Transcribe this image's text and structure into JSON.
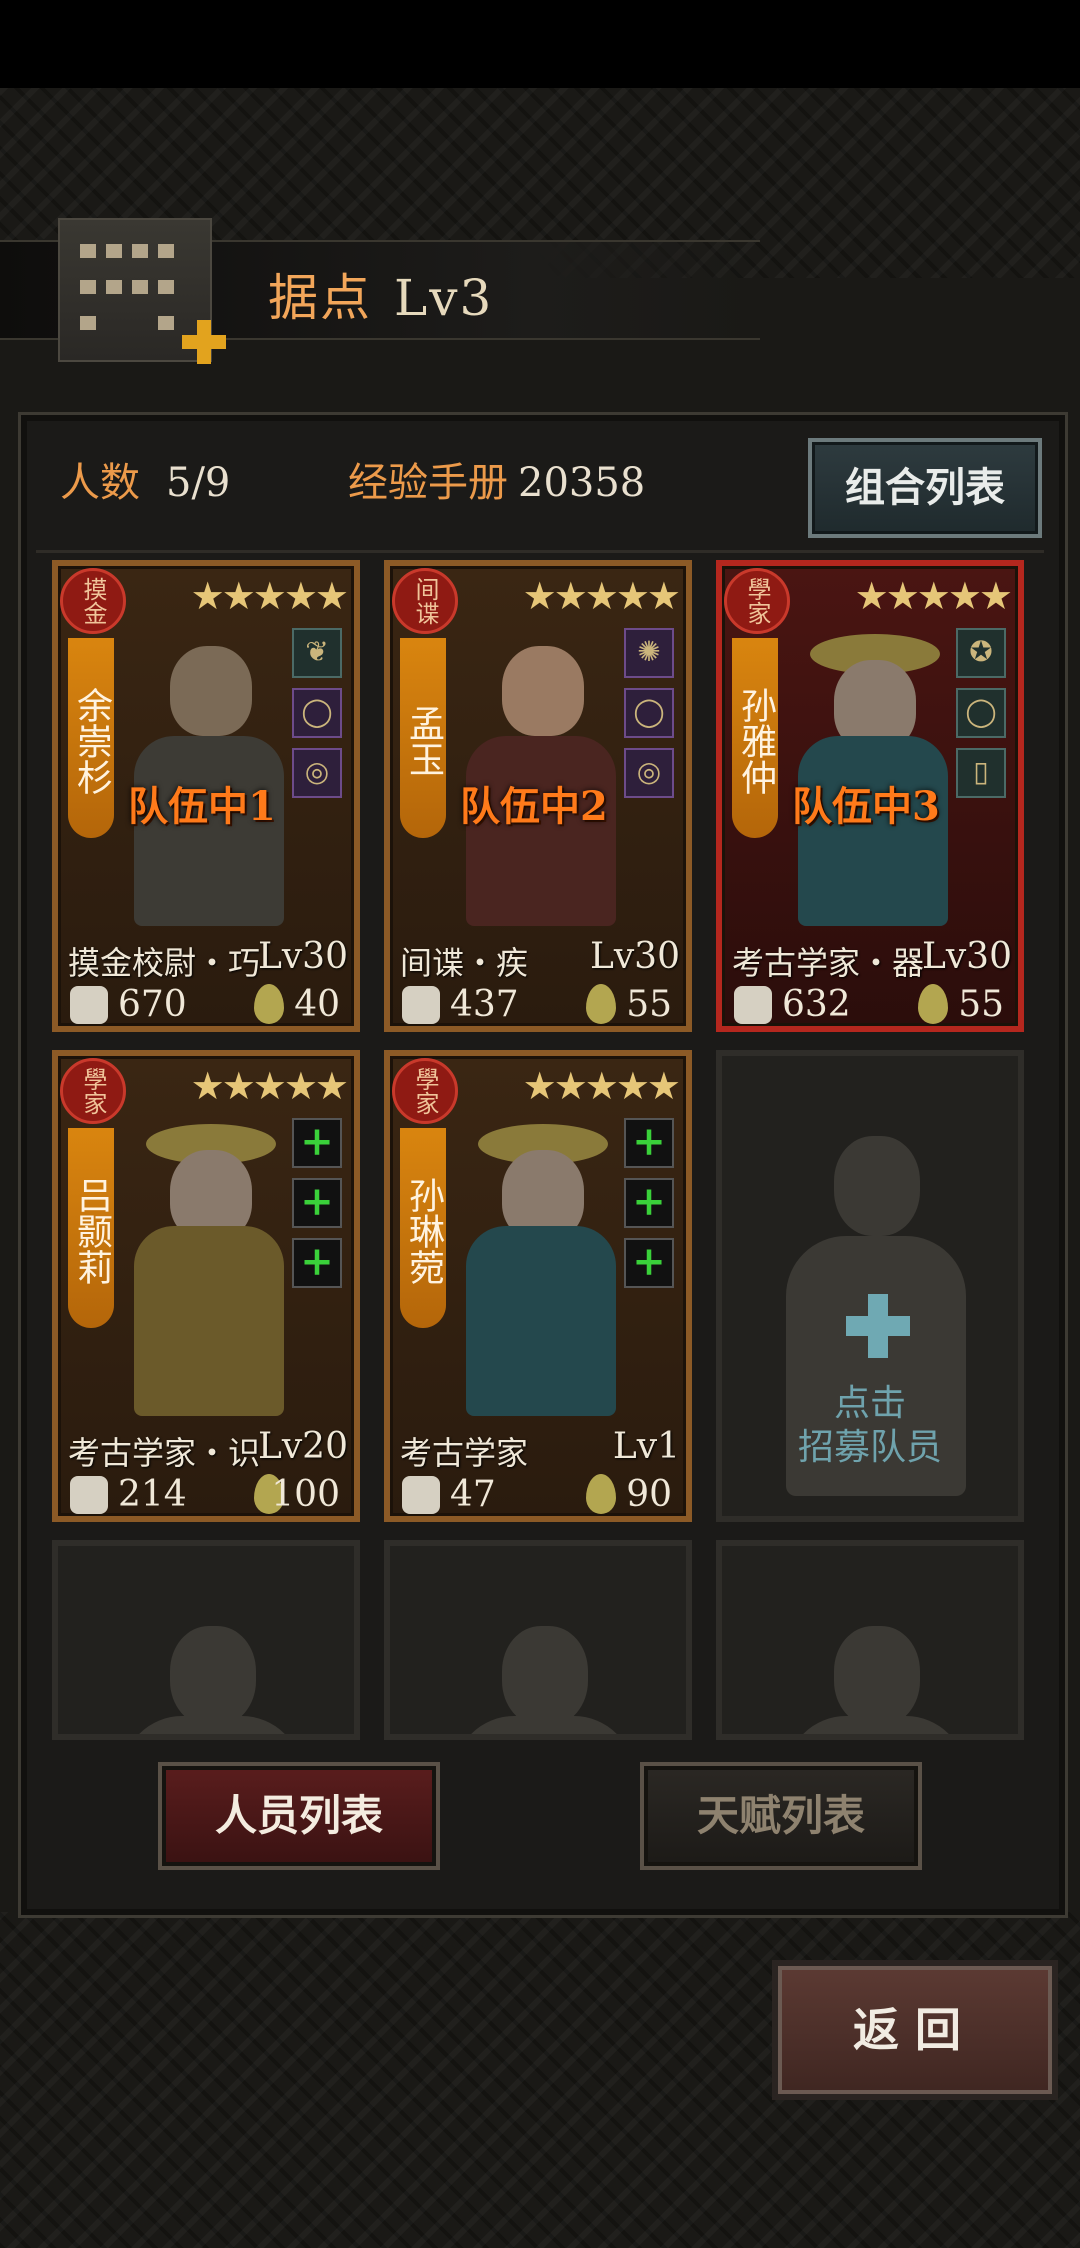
{
  "header": {
    "title": "据点",
    "level": "Lv3"
  },
  "stats": {
    "members_label": "人数",
    "members_value": "5/9",
    "exp_label": "经验手册",
    "exp_value": "20358",
    "combo_button": "组合列表"
  },
  "cards": [
    {
      "class": "摸金",
      "stars": "★★★★★",
      "name": "余崇杉",
      "team": "队伍中1",
      "role": "摸金校尉・巧",
      "level": "Lv30",
      "power": "670",
      "stamina": "40",
      "equip": [
        "potion-icon",
        "ring-icon",
        "ring-icon"
      ]
    },
    {
      "class": "间谍",
      "stars": "★★★★★",
      "name": "孟玉",
      "team": "队伍中2",
      "role": "间谍・疾",
      "level": "Lv30",
      "power": "437",
      "stamina": "55",
      "equip": [
        "spider-icon",
        "ring-icon",
        "ring-icon"
      ]
    },
    {
      "class": "學家",
      "stars": "★★★★★",
      "name": "孙雅仲",
      "team": "队伍中3",
      "role": "考古学家・器",
      "level": "Lv30",
      "power": "632",
      "stamina": "55",
      "equip": [
        "bag-icon",
        "bracelet-icon",
        "phone-icon"
      ]
    },
    {
      "class": "學家",
      "stars": "★★★★★",
      "name": "吕颢莉",
      "team": "",
      "role": "考古学家・识",
      "level": "Lv20",
      "power": "214",
      "stamina": "100",
      "equip": [
        "add-icon",
        "add-icon",
        "add-icon"
      ]
    },
    {
      "class": "學家",
      "stars": "★★★★★",
      "name": "孙琳菀",
      "team": "",
      "role": "考古学家",
      "level": "Lv1",
      "power": "47",
      "stamina": "90",
      "equip": [
        "add-icon",
        "add-icon",
        "add-icon"
      ]
    }
  ],
  "recruit": {
    "line1": "点击",
    "line2": "招募队员"
  },
  "tabs": {
    "members": "人员列表",
    "talents": "天赋列表"
  },
  "back": "返回",
  "colors": {
    "accent_orange": "#ec9a4a",
    "card_border": "#8c5a26",
    "active_card_border": "#b5271e"
  }
}
